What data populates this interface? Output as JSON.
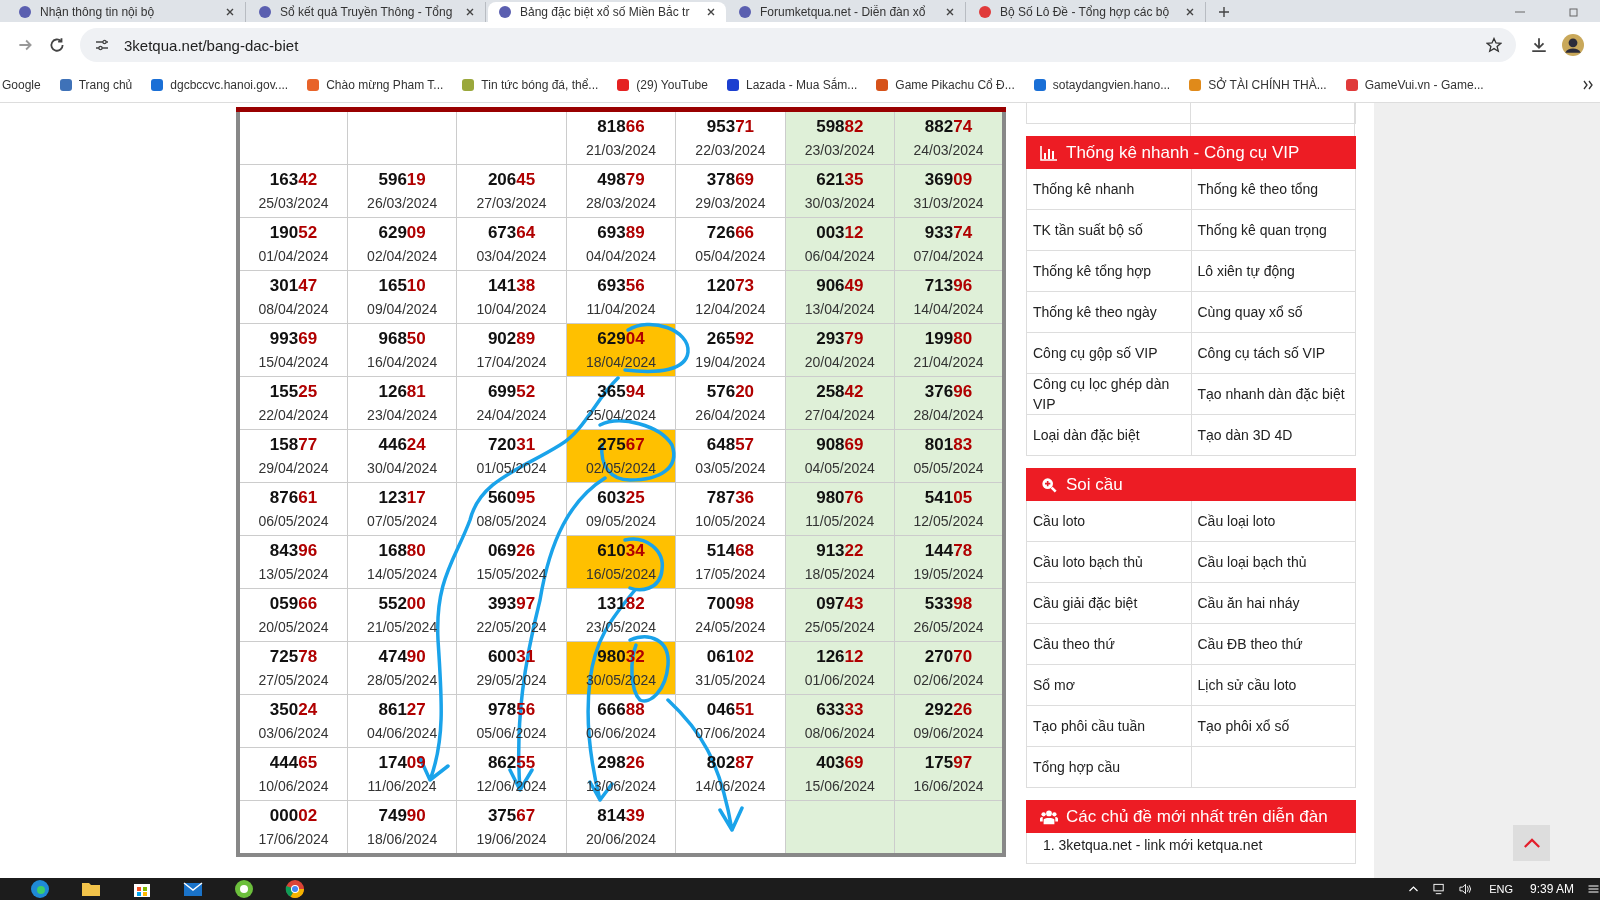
{
  "tabs": [
    {
      "title": "Nhận thông tin nội bộ",
      "selected": false
    },
    {
      "title": "Sổ kết quả Truyền Thông - Tổng",
      "selected": false
    },
    {
      "title": "Bảng đặc biệt xổ số Miền Bắc tr",
      "selected": true
    },
    {
      "title": "Forumketqua.net - Diễn đàn xổ",
      "selected": false
    },
    {
      "title": "Bộ Số Lô Đề - Tổng hợp các bộ",
      "selected": false
    }
  ],
  "address_bar": {
    "url": "3ketqua.net/bang-dac-biet"
  },
  "bookmarks": [
    "Google",
    "Trang chủ",
    "dgcbccvc.hanoi.gov....",
    "Chào mừng Pham T...",
    "Tin tức bóng đá, thể...",
    "(29) YouTube",
    "Lazada - Mua Sắm...",
    "Game Pikachu Cổ Đ...",
    "sotaydangvien.hano...",
    "SỞ TÀI CHÍNH THÀ...",
    "GameVui.vn - Game..."
  ],
  "table": {
    "columns": [
      {
        "shaded": false
      },
      {
        "shaded": false
      },
      {
        "shaded": false
      },
      {
        "shaded": false
      },
      {
        "shaded": false
      },
      {
        "shaded": true
      },
      {
        "shaded": true
      }
    ],
    "rows": [
      [
        null,
        null,
        null,
        {
          "number": "81866",
          "date": "21/03/2024",
          "highlighted": false
        },
        {
          "number": "95371",
          "date": "22/03/2024",
          "highlighted": false
        },
        {
          "number": "59882",
          "date": "23/03/2024",
          "highlighted": false
        },
        {
          "number": "88274",
          "date": "24/03/2024",
          "highlighted": false
        }
      ],
      [
        {
          "number": "16342",
          "date": "25/03/2024",
          "highlighted": false
        },
        {
          "number": "59619",
          "date": "26/03/2024",
          "highlighted": false
        },
        {
          "number": "20645",
          "date": "27/03/2024",
          "highlighted": false
        },
        {
          "number": "49879",
          "date": "28/03/2024",
          "highlighted": false
        },
        {
          "number": "37869",
          "date": "29/03/2024",
          "highlighted": false
        },
        {
          "number": "62135",
          "date": "30/03/2024",
          "highlighted": false
        },
        {
          "number": "36909",
          "date": "31/03/2024",
          "highlighted": false
        }
      ],
      [
        {
          "number": "19052",
          "date": "01/04/2024",
          "highlighted": false
        },
        {
          "number": "62909",
          "date": "02/04/2024",
          "highlighted": false
        },
        {
          "number": "67364",
          "date": "03/04/2024",
          "highlighted": false
        },
        {
          "number": "69389",
          "date": "04/04/2024",
          "highlighted": false
        },
        {
          "number": "72666",
          "date": "05/04/2024",
          "highlighted": false
        },
        {
          "number": "00312",
          "date": "06/04/2024",
          "highlighted": false
        },
        {
          "number": "93374",
          "date": "07/04/2024",
          "highlighted": false
        }
      ],
      [
        {
          "number": "30147",
          "date": "08/04/2024",
          "highlighted": false
        },
        {
          "number": "16510",
          "date": "09/04/2024",
          "highlighted": false
        },
        {
          "number": "14138",
          "date": "10/04/2024",
          "highlighted": false
        },
        {
          "number": "69356",
          "date": "11/04/2024",
          "highlighted": false
        },
        {
          "number": "12073",
          "date": "12/04/2024",
          "highlighted": false
        },
        {
          "number": "90649",
          "date": "13/04/2024",
          "highlighted": false
        },
        {
          "number": "71396",
          "date": "14/04/2024",
          "highlighted": false
        }
      ],
      [
        {
          "number": "99369",
          "date": "15/04/2024",
          "highlighted": false
        },
        {
          "number": "96850",
          "date": "16/04/2024",
          "highlighted": false
        },
        {
          "number": "90289",
          "date": "17/04/2024",
          "highlighted": false
        },
        {
          "number": "62904",
          "date": "18/04/2024",
          "highlighted": true
        },
        {
          "number": "26592",
          "date": "19/04/2024",
          "highlighted": false
        },
        {
          "number": "29379",
          "date": "20/04/2024",
          "highlighted": false
        },
        {
          "number": "19980",
          "date": "21/04/2024",
          "highlighted": false
        }
      ],
      [
        {
          "number": "15525",
          "date": "22/04/2024",
          "highlighted": false
        },
        {
          "number": "12681",
          "date": "23/04/2024",
          "highlighted": false
        },
        {
          "number": "69952",
          "date": "24/04/2024",
          "highlighted": false
        },
        {
          "number": "36594",
          "date": "25/04/2024",
          "highlighted": false
        },
        {
          "number": "57620",
          "date": "26/04/2024",
          "highlighted": false
        },
        {
          "number": "25842",
          "date": "27/04/2024",
          "highlighted": false
        },
        {
          "number": "37696",
          "date": "28/04/2024",
          "highlighted": false
        }
      ],
      [
        {
          "number": "15877",
          "date": "29/04/2024",
          "highlighted": false
        },
        {
          "number": "44624",
          "date": "30/04/2024",
          "highlighted": false
        },
        {
          "number": "72031",
          "date": "01/05/2024",
          "highlighted": false
        },
        {
          "number": "27567",
          "date": "02/05/2024",
          "highlighted": true
        },
        {
          "number": "64857",
          "date": "03/05/2024",
          "highlighted": false
        },
        {
          "number": "90869",
          "date": "04/05/2024",
          "highlighted": false
        },
        {
          "number": "80183",
          "date": "05/05/2024",
          "highlighted": false
        }
      ],
      [
        {
          "number": "87661",
          "date": "06/05/2024",
          "highlighted": false
        },
        {
          "number": "12317",
          "date": "07/05/2024",
          "highlighted": false
        },
        {
          "number": "56095",
          "date": "08/05/2024",
          "highlighted": false
        },
        {
          "number": "60325",
          "date": "09/05/2024",
          "highlighted": false
        },
        {
          "number": "78736",
          "date": "10/05/2024",
          "highlighted": false
        },
        {
          "number": "98076",
          "date": "11/05/2024",
          "highlighted": false
        },
        {
          "number": "54105",
          "date": "12/05/2024",
          "highlighted": false
        }
      ],
      [
        {
          "number": "84396",
          "date": "13/05/2024",
          "highlighted": false
        },
        {
          "number": "16880",
          "date": "14/05/2024",
          "highlighted": false
        },
        {
          "number": "06926",
          "date": "15/05/2024",
          "highlighted": false
        },
        {
          "number": "61034",
          "date": "16/05/2024",
          "highlighted": true
        },
        {
          "number": "51468",
          "date": "17/05/2024",
          "highlighted": false
        },
        {
          "number": "91322",
          "date": "18/05/2024",
          "highlighted": false
        },
        {
          "number": "14478",
          "date": "19/05/2024",
          "highlighted": false
        }
      ],
      [
        {
          "number": "05966",
          "date": "20/05/2024",
          "highlighted": false
        },
        {
          "number": "55200",
          "date": "21/05/2024",
          "highlighted": false
        },
        {
          "number": "39397",
          "date": "22/05/2024",
          "highlighted": false
        },
        {
          "number": "13182",
          "date": "23/05/2024",
          "highlighted": false
        },
        {
          "number": "70098",
          "date": "24/05/2024",
          "highlighted": false
        },
        {
          "number": "09743",
          "date": "25/05/2024",
          "highlighted": false
        },
        {
          "number": "53398",
          "date": "26/05/2024",
          "highlighted": false
        }
      ],
      [
        {
          "number": "72578",
          "date": "27/05/2024",
          "highlighted": false
        },
        {
          "number": "47490",
          "date": "28/05/2024",
          "highlighted": false
        },
        {
          "number": "60031",
          "date": "29/05/2024",
          "highlighted": false
        },
        {
          "number": "98032",
          "date": "30/05/2024",
          "highlighted": true
        },
        {
          "number": "06102",
          "date": "31/05/2024",
          "highlighted": false
        },
        {
          "number": "12612",
          "date": "01/06/2024",
          "highlighted": false
        },
        {
          "number": "27070",
          "date": "02/06/2024",
          "highlighted": false
        }
      ],
      [
        {
          "number": "35024",
          "date": "03/06/2024",
          "highlighted": false
        },
        {
          "number": "86127",
          "date": "04/06/2024",
          "highlighted": false
        },
        {
          "number": "97856",
          "date": "05/06/2024",
          "highlighted": false
        },
        {
          "number": "66688",
          "date": "06/06/2024",
          "highlighted": false
        },
        {
          "number": "04651",
          "date": "07/06/2024",
          "highlighted": false
        },
        {
          "number": "63333",
          "date": "08/06/2024",
          "highlighted": false
        },
        {
          "number": "29226",
          "date": "09/06/2024",
          "highlighted": false
        }
      ],
      [
        {
          "number": "44465",
          "date": "10/06/2024",
          "highlighted": false
        },
        {
          "number": "17409",
          "date": "11/06/2024",
          "highlighted": false
        },
        {
          "number": "86255",
          "date": "12/06/2024",
          "highlighted": false
        },
        {
          "number": "29826",
          "date": "13/06/2024",
          "highlighted": false
        },
        {
          "number": "80287",
          "date": "14/06/2024",
          "highlighted": false
        },
        {
          "number": "40369",
          "date": "15/06/2024",
          "highlighted": false
        },
        {
          "number": "17597",
          "date": "16/06/2024",
          "highlighted": false
        }
      ],
      [
        {
          "number": "00002",
          "date": "17/06/2024",
          "highlighted": false
        },
        {
          "number": "74990",
          "date": "18/06/2024",
          "highlighted": false
        },
        {
          "number": "37567",
          "date": "19/06/2024",
          "highlighted": false
        },
        {
          "number": "81439",
          "date": "20/06/2024",
          "highlighted": false
        },
        null,
        null,
        null
      ]
    ]
  },
  "sidebar": {
    "panels": [
      {
        "kind": "stats",
        "title": "Thống kê nhanh - Công cụ VIP",
        "rows": [
          [
            "Thống kê nhanh",
            "Thống kê theo tổng"
          ],
          [
            "TK tần suất bộ số",
            "Thống kê quan trọng"
          ],
          [
            "Thống kê tổng hợp",
            "Lô xiên tự động"
          ],
          [
            "Thống kê theo ngày",
            "Cùng quay xổ số"
          ],
          [
            "Công cụ gộp số VIP",
            "Công cụ tách số VIP"
          ],
          [
            "Công cụ lọc ghép dàn VIP",
            "Tạo nhanh dàn đặc biệt"
          ],
          [
            "Loại dàn đặc biệt",
            "Tạo dàn 3D 4D"
          ]
        ]
      },
      {
        "kind": "search",
        "title": "Soi cầu",
        "rows": [
          [
            "Cầu loto",
            "Cầu loại loto"
          ],
          [
            "Cầu loto bạch thủ",
            "Cầu loại bạch thủ"
          ],
          [
            "Cầu giải đặc biệt",
            "Cầu ăn hai nháy"
          ],
          [
            "Cầu theo thứ",
            "Cầu ĐB theo thứ"
          ],
          [
            "Sổ mơ",
            "Lịch sử cầu loto"
          ],
          [
            "Tạo phôi cầu tuần",
            "Tạo phôi xổ số"
          ],
          [
            "Tổng hợp cầu"
          ]
        ]
      },
      {
        "kind": "users",
        "title": "Các chủ đề mới nhất trên diễn đàn",
        "items": [
          "1. 3ketqua.net - link mới ketqua.net"
        ]
      }
    ]
  },
  "taskbar": {
    "language": "ENG",
    "time": "9:39 AM"
  }
}
